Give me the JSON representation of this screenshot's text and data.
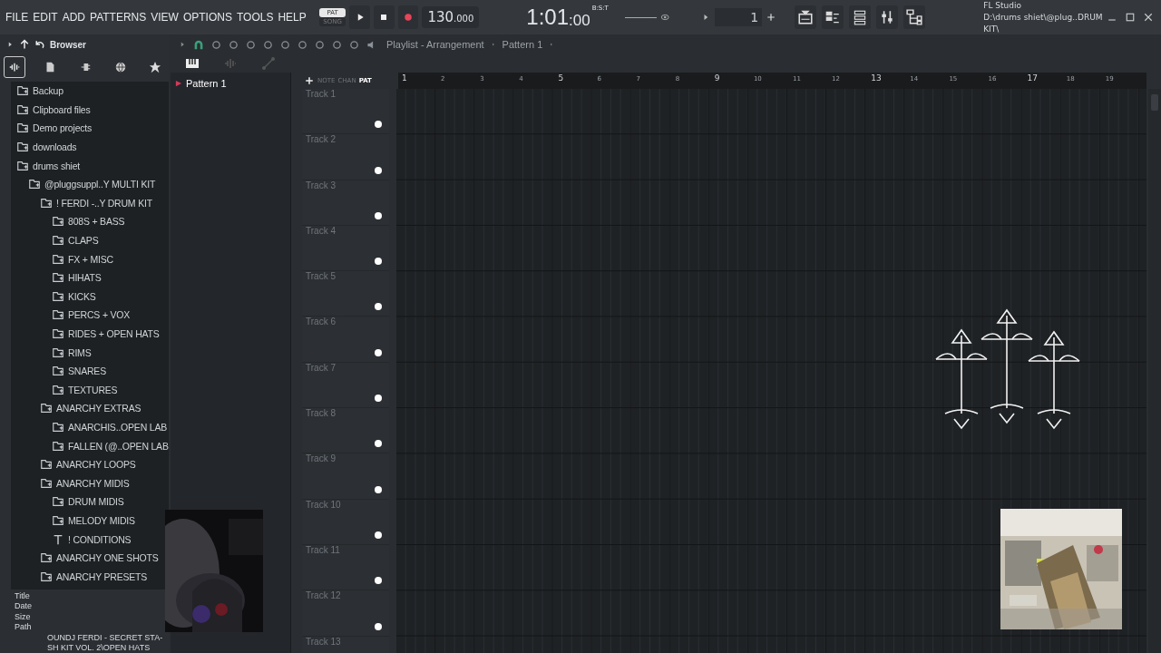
{
  "menu": [
    "FILE",
    "EDIT",
    "ADD",
    "PATTERNS",
    "VIEW",
    "OPTIONS",
    "TOOLS",
    "HELP"
  ],
  "transport": {
    "modes": [
      {
        "label": "PAT",
        "selected": true
      },
      {
        "label": "SONG",
        "selected": false
      }
    ],
    "tempo": "130",
    "tempo_fraction": ".000",
    "time": "1:01",
    "time_fraction": ":00",
    "time_format": "B:S:T",
    "pattern": "1"
  },
  "hint": {
    "title": "FL Studio",
    "path": "D:\\drums shiet\\@plug..DRUM KIT\\"
  },
  "browser": {
    "title": "Browser",
    "tabs": [
      {
        "selected": true
      },
      {
        "selected": false
      },
      {
        "selected": false
      },
      {
        "selected": false
      },
      {
        "selected": false
      }
    ],
    "tree": [
      {
        "label": "Backup",
        "kind": "folder"
      },
      {
        "label": "Clipboard files",
        "kind": "folder"
      },
      {
        "label": "Demo projects",
        "kind": "folder"
      },
      {
        "label": "downloads",
        "kind": "folder"
      },
      {
        "label": "drums shiet",
        "kind": "folder",
        "children": [
          {
            "label": "@pluggsuppl..Y MULTI KIT",
            "kind": "folder",
            "children": [
              {
                "label": "! FERDI -..Y DRUM KIT",
                "kind": "folder",
                "children": [
                  {
                    "label": "808S + BASS",
                    "kind": "folder"
                  },
                  {
                    "label": "CLAPS",
                    "kind": "folder"
                  },
                  {
                    "label": "FX + MISC",
                    "kind": "folder"
                  },
                  {
                    "label": "HIHATS",
                    "kind": "folder"
                  },
                  {
                    "label": "KICKS",
                    "kind": "folder"
                  },
                  {
                    "label": "PERCS + VOX",
                    "kind": "folder"
                  },
                  {
                    "label": "RIDES + OPEN HATS",
                    "kind": "folder"
                  },
                  {
                    "label": "RIMS",
                    "kind": "folder"
                  },
                  {
                    "label": "SNARES",
                    "kind": "folder"
                  },
                  {
                    "label": "TEXTURES",
                    "kind": "folder"
                  }
                ]
              },
              {
                "label": "ANARCHY EXTRAS",
                "kind": "folder",
                "children": [
                  {
                    "label": "ANARCHIS..OPEN LAB",
                    "kind": "folder"
                  },
                  {
                    "label": "FALLEN (@..OPEN LAB",
                    "kind": "folder"
                  }
                ]
              },
              {
                "label": "ANARCHY LOOPS",
                "kind": "folder"
              },
              {
                "label": "ANARCHY MIDIS",
                "kind": "folder",
                "children": [
                  {
                    "label": "DRUM MIDIS",
                    "kind": "folder"
                  },
                  {
                    "label": "MELODY MIDIS",
                    "kind": "folder"
                  },
                  {
                    "label": "! CONDITIONS",
                    "kind": "file"
                  }
                ]
              },
              {
                "label": "ANARCHY ONE SHOTS",
                "kind": "folder"
              },
              {
                "label": "ANARCHY PRESETS",
                "kind": "folder"
              }
            ]
          }
        ]
      }
    ]
  },
  "info": {
    "labels": [
      "Title",
      "Date",
      "Size",
      "Path"
    ],
    "path_lines": [
      "OUNDJ FERDI - SECRET STA-",
      "SH KIT VOL. 2\\OPEN HATS"
    ]
  },
  "playlist": {
    "title": "Playlist - Arrangement",
    "pattern": "Pattern 1",
    "patterns": [
      {
        "name": "Pattern 1",
        "selected": true
      }
    ],
    "picker": [
      {
        "label": "NOTE",
        "selected": false
      },
      {
        "label": "CHAN",
        "selected": false
      },
      {
        "label": "PAT",
        "selected": true
      }
    ],
    "ruler": [
      "1",
      "2",
      "3",
      "4",
      "5",
      "6",
      "7",
      "8",
      "9",
      "10",
      "11",
      "12",
      "13",
      "14",
      "15",
      "16",
      "17",
      "18",
      "19"
    ],
    "tracks": [
      {
        "name": "Track 1",
        "enabled": true
      },
      {
        "name": "Track 2",
        "enabled": true
      },
      {
        "name": "Track 3",
        "enabled": true
      },
      {
        "name": "Track 4",
        "enabled": true
      },
      {
        "name": "Track 5",
        "enabled": true
      },
      {
        "name": "Track 6",
        "enabled": true
      },
      {
        "name": "Track 7",
        "enabled": true
      },
      {
        "name": "Track 8",
        "enabled": true
      },
      {
        "name": "Track 9",
        "enabled": true
      },
      {
        "name": "Track 10",
        "enabled": true
      },
      {
        "name": "Track 11",
        "enabled": true
      },
      {
        "name": "Track 12",
        "enabled": true
      },
      {
        "name": "Track 13"
      }
    ]
  },
  "overlays": [
    {
      "kind": "crosses"
    },
    {
      "kind": "picture"
    },
    {
      "kind": "webcam"
    }
  ]
}
